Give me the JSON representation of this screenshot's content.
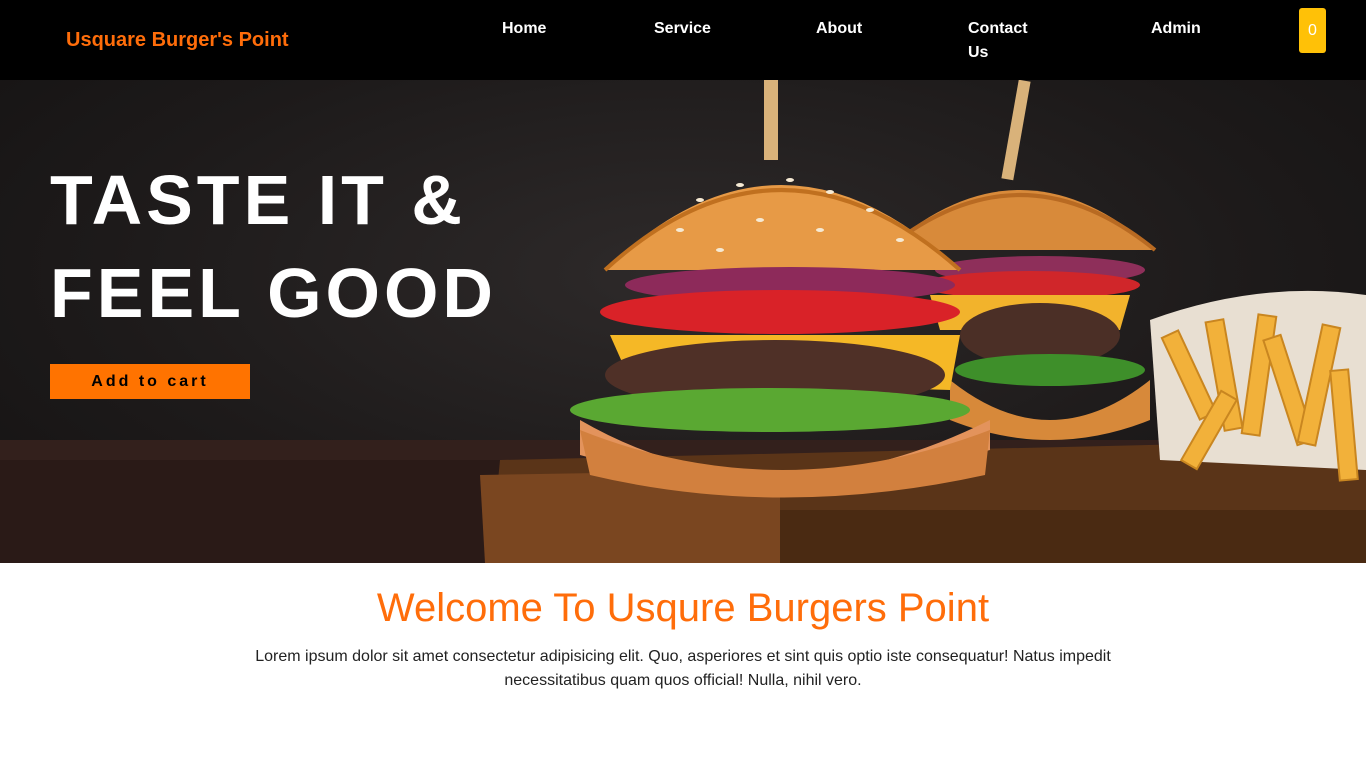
{
  "theme": {
    "accent": "#ff6d0a",
    "nav_bg": "#000000",
    "cart_bg": "#ffc107",
    "button_bg": "#ff7300"
  },
  "nav": {
    "brand": "Usquare Burger's Point",
    "links": [
      "Home",
      "Service",
      "About",
      "Contact Us",
      "Admin"
    ],
    "cart_count": "0"
  },
  "hero": {
    "title": "TASTE IT & FEEL GOOD",
    "button_label": "Add to cart",
    "image": "burger-and-fries-photo"
  },
  "welcome": {
    "title": "Welcome To Usqure Burgers Point",
    "text": "Lorem ipsum dolor sit amet consectetur adipisicing elit. Quo, asperiores et sint quis optio iste consequatur! Natus impedit necessitatibus quam quos official! Nulla, nihil vero."
  }
}
